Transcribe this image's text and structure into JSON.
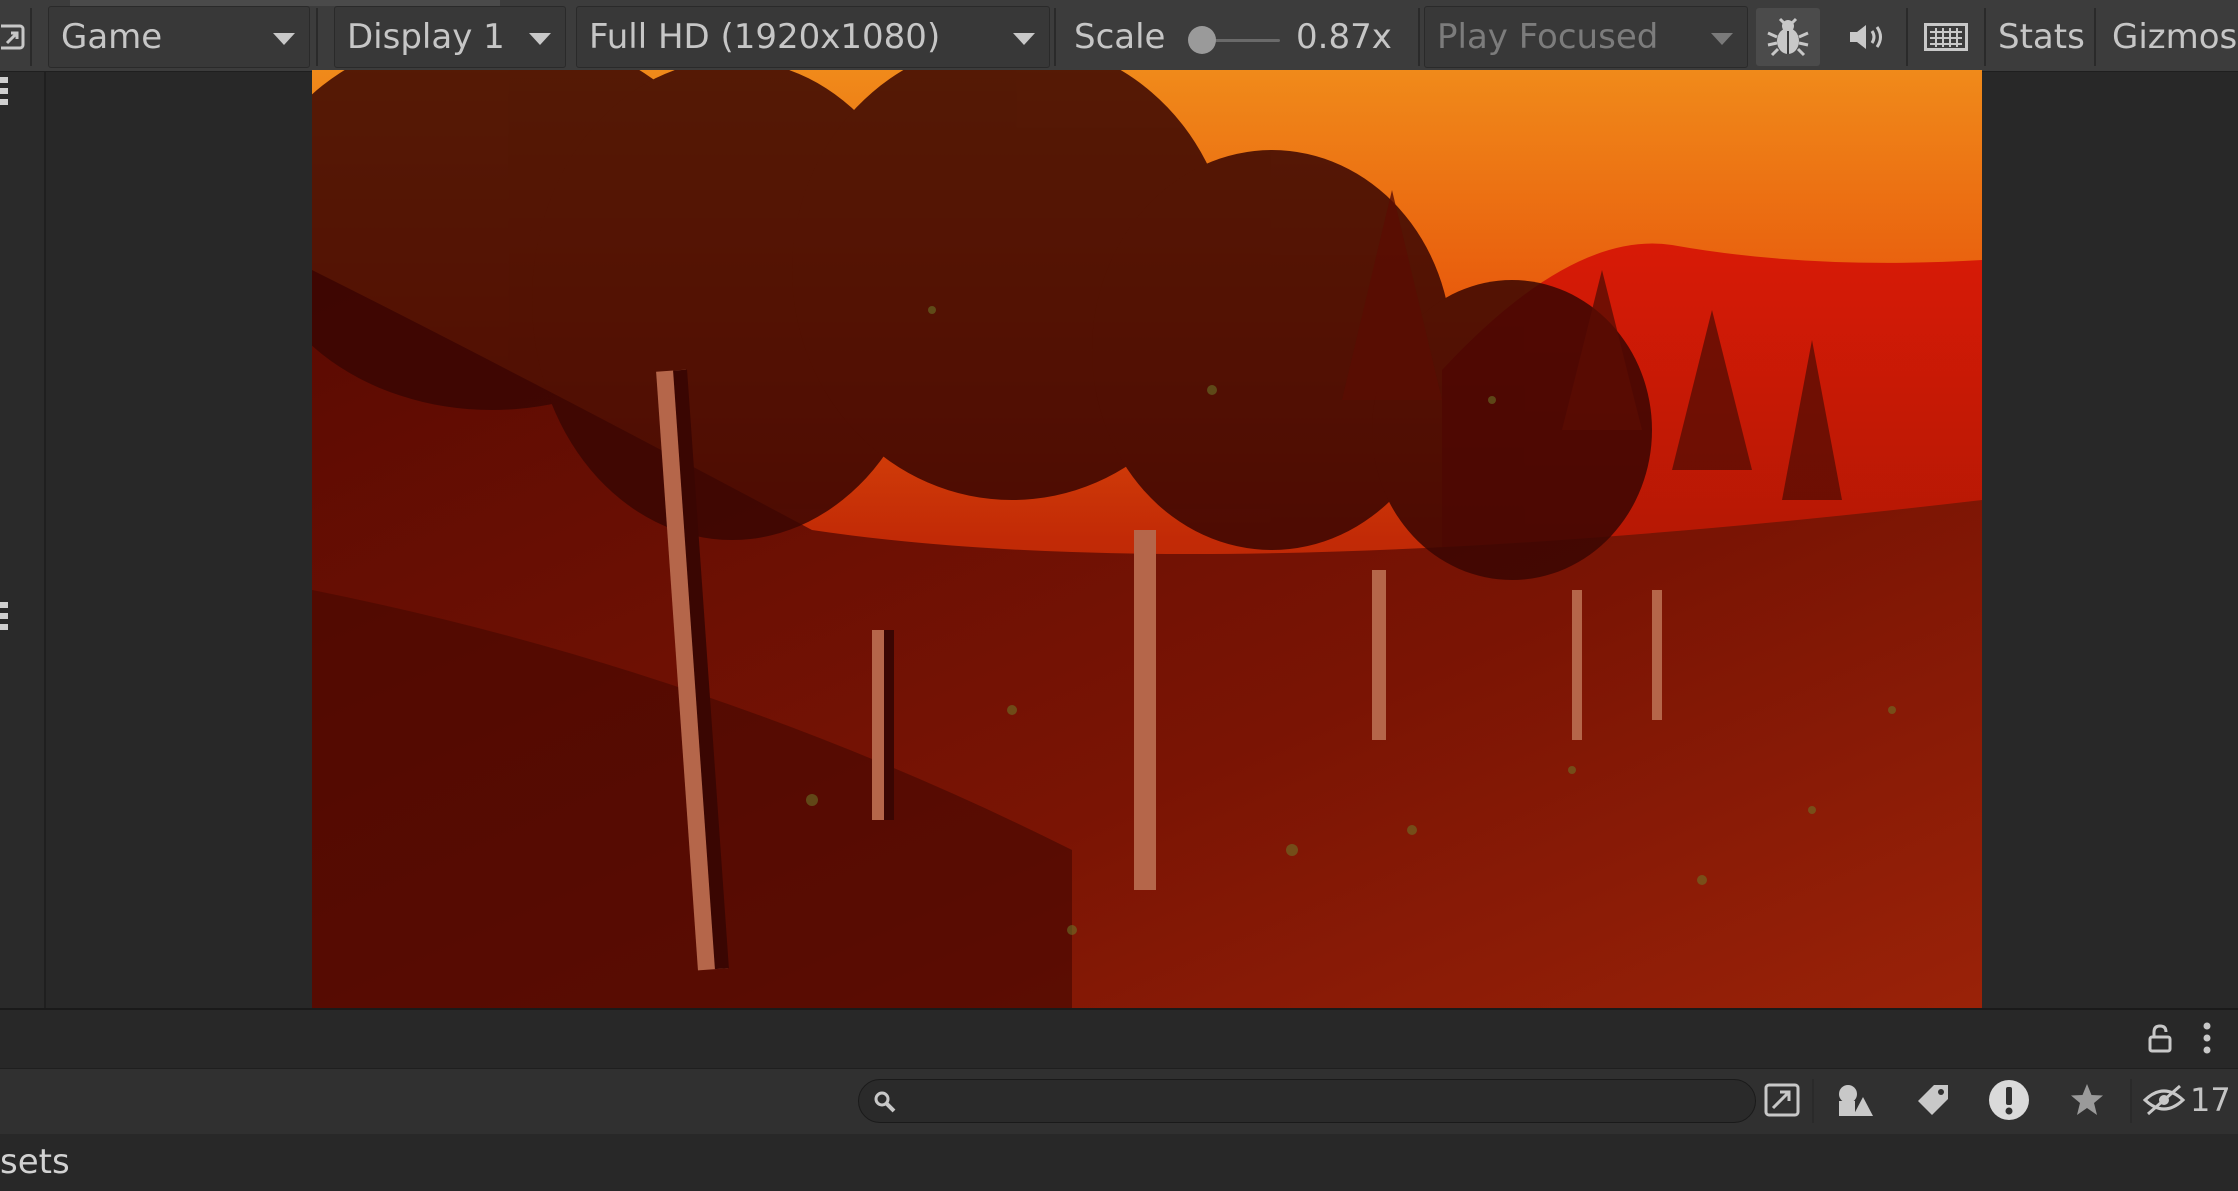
{
  "toolbar": {
    "view_dropdown": "Game",
    "display_dropdown": "Display 1",
    "resolution_dropdown": "Full HD (1920x1080)",
    "scale_label": "Scale",
    "scale_value": "0.87x",
    "scale_fraction": 0.87,
    "play_mode_dropdown": "Play Focused",
    "stats_label": "Stats",
    "gizmos_label": "Gizmos"
  },
  "icons": {
    "maximize": "maximize-icon",
    "bug": "bug-icon",
    "audio": "speaker-icon",
    "keyboard": "keyboard-icon",
    "lock": "lock-icon",
    "kebab": "kebab-menu-icon",
    "search": "search-icon",
    "open_external": "open-in-window-icon",
    "shapes_filter": "shapes-filter-icon",
    "label_filter": "tag-icon",
    "error_filter": "exclamation-icon",
    "favorites": "star-icon",
    "hidden_count": "eye-off-icon"
  },
  "project_browser": {
    "search_placeholder": "",
    "hidden_packages_count": "17",
    "bottom_tab_label": "sets"
  },
  "colors": {
    "toolbar_bg": "#3c3c3c",
    "panel_bg": "#282828",
    "text": "#c6c6c6",
    "scene_sky": "#e86a10",
    "scene_ground": "#6a0c02"
  }
}
